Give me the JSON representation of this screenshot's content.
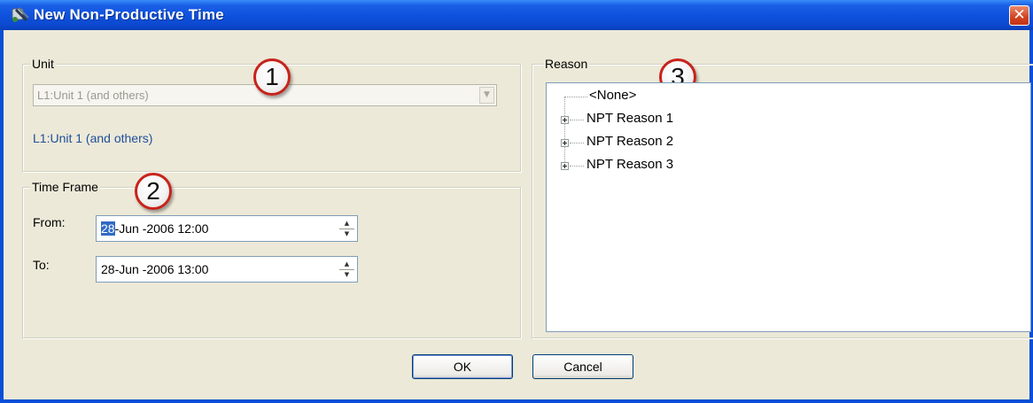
{
  "window": {
    "title": "New Non-Productive Time",
    "app_icon": "app-icon",
    "close_glyph": "✕"
  },
  "unit": {
    "legend": "Unit",
    "combo_value": "L1:Unit 1 (and others)",
    "link_text": "L1:Unit 1 (and others)",
    "callout": "1"
  },
  "time_frame": {
    "legend": "Time Frame",
    "callout": "2",
    "from_label": "From:",
    "from_selected": "28",
    "from_rest": "-Jun -2006 12:00",
    "to_label": "To:",
    "to_value": "28-Jun -2006 13:00"
  },
  "reason": {
    "legend": "Reason",
    "callout": "3",
    "items": [
      {
        "label": "<None>",
        "expandable": false
      },
      {
        "label": "NPT Reason 1",
        "expandable": true
      },
      {
        "label": "NPT Reason 2",
        "expandable": true
      },
      {
        "label": "NPT Reason 3",
        "expandable": true
      }
    ]
  },
  "buttons": {
    "ok": "OK",
    "cancel": "Cancel"
  },
  "colors": {
    "titlebar": "#0f52de",
    "dialog_bg": "#ece9d8",
    "selection": "#316ac5",
    "link": "#1f4f9a",
    "callout_border": "#c8231b"
  }
}
